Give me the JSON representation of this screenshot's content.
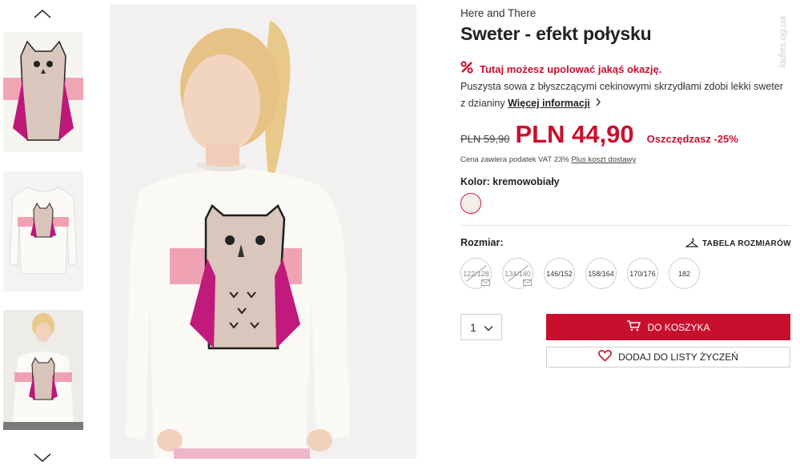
{
  "gallery": {
    "thumbnails": [
      {
        "alt": "owl-sweater-detail"
      },
      {
        "alt": "sweater-front"
      },
      {
        "alt": "model-wearing-sweater"
      }
    ]
  },
  "product": {
    "brand": "Here and There",
    "title": "Sweter - efekt połysku",
    "deal_text": "Tutaj możesz upolować jakąś okazję.",
    "description": "Puszysta sowa z błyszczącymi cekinowymi skrzydłami zdobi lekki sweter z dzianiny",
    "more_info": "Więcej informacji",
    "old_price": "PLN 59,90",
    "price": "PLN 44,90",
    "savings": "Oszczędzasz -25%",
    "vat_note": "Cena zawiera podatek VAT 23%",
    "shipping_link": "Plus koszt dostawy",
    "color_label": "Kolor: kremowobiały",
    "color_hex": "#f4f1e8",
    "size_label": "Rozmiar:",
    "size_table": "TABELA ROZMIARÓW",
    "sizes": [
      {
        "label": "122/128",
        "available": false
      },
      {
        "label": "134/140",
        "available": false
      },
      {
        "label": "146/152",
        "available": true
      },
      {
        "label": "158/164",
        "available": true
      },
      {
        "label": "170/176",
        "available": true
      },
      {
        "label": "182",
        "available": true
      }
    ],
    "quantity": "1",
    "add_to_cart": "DO KOSZYKA",
    "add_to_wishlist": "DODAJ DO LISTY ŻYCZEŃ"
  },
  "watermark": "ladies.ug.ua",
  "colors": {
    "accent": "#c8102e",
    "border": "#cfcfcf"
  }
}
